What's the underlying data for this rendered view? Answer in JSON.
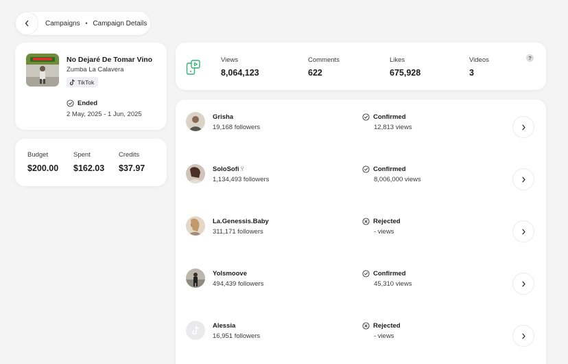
{
  "breadcrumb": {
    "parent": "Campaigns",
    "separator": "•",
    "current": "Campaign Details"
  },
  "campaign": {
    "title": "No Dejaré De Tomar Vino",
    "artist": "Zumba La Calavera",
    "platform": "TikTok",
    "status": "Ended",
    "dates": "2 May, 2025 - 1 Jun, 2025"
  },
  "budget": {
    "budget_label": "Budget",
    "budget_value": "$200.00",
    "spent_label": "Spent",
    "spent_value": "$162.03",
    "credits_label": "Credits",
    "credits_value": "$37.97"
  },
  "stats": {
    "views_label": "Views",
    "views_value": "8,064,123",
    "comments_label": "Comments",
    "comments_value": "622",
    "likes_label": "Likes",
    "likes_value": "675,928",
    "videos_label": "Videos",
    "videos_value": "3",
    "help": "?"
  },
  "creators": [
    {
      "name": "Grisha",
      "followers": "19,168 followers",
      "status": "Confirmed",
      "views": "12,813 views"
    },
    {
      "name": "SoloSofi",
      "followers": "1,134,493 followers",
      "status": "Confirmed",
      "views": "8,006,000 views"
    },
    {
      "name": "La.Genessis.Baby",
      "followers": "311,171 followers",
      "status": "Rejected",
      "views": "- views"
    },
    {
      "name": "Yolsmoove",
      "followers": "494,439 followers",
      "status": "Confirmed",
      "views": "45,310 views"
    },
    {
      "name": "Alessia",
      "followers": "16,951 followers",
      "status": "Rejected",
      "views": "- views"
    }
  ],
  "colors": {
    "accent": "#2bb673",
    "background": "#f4f4f5",
    "card": "#ffffff"
  }
}
